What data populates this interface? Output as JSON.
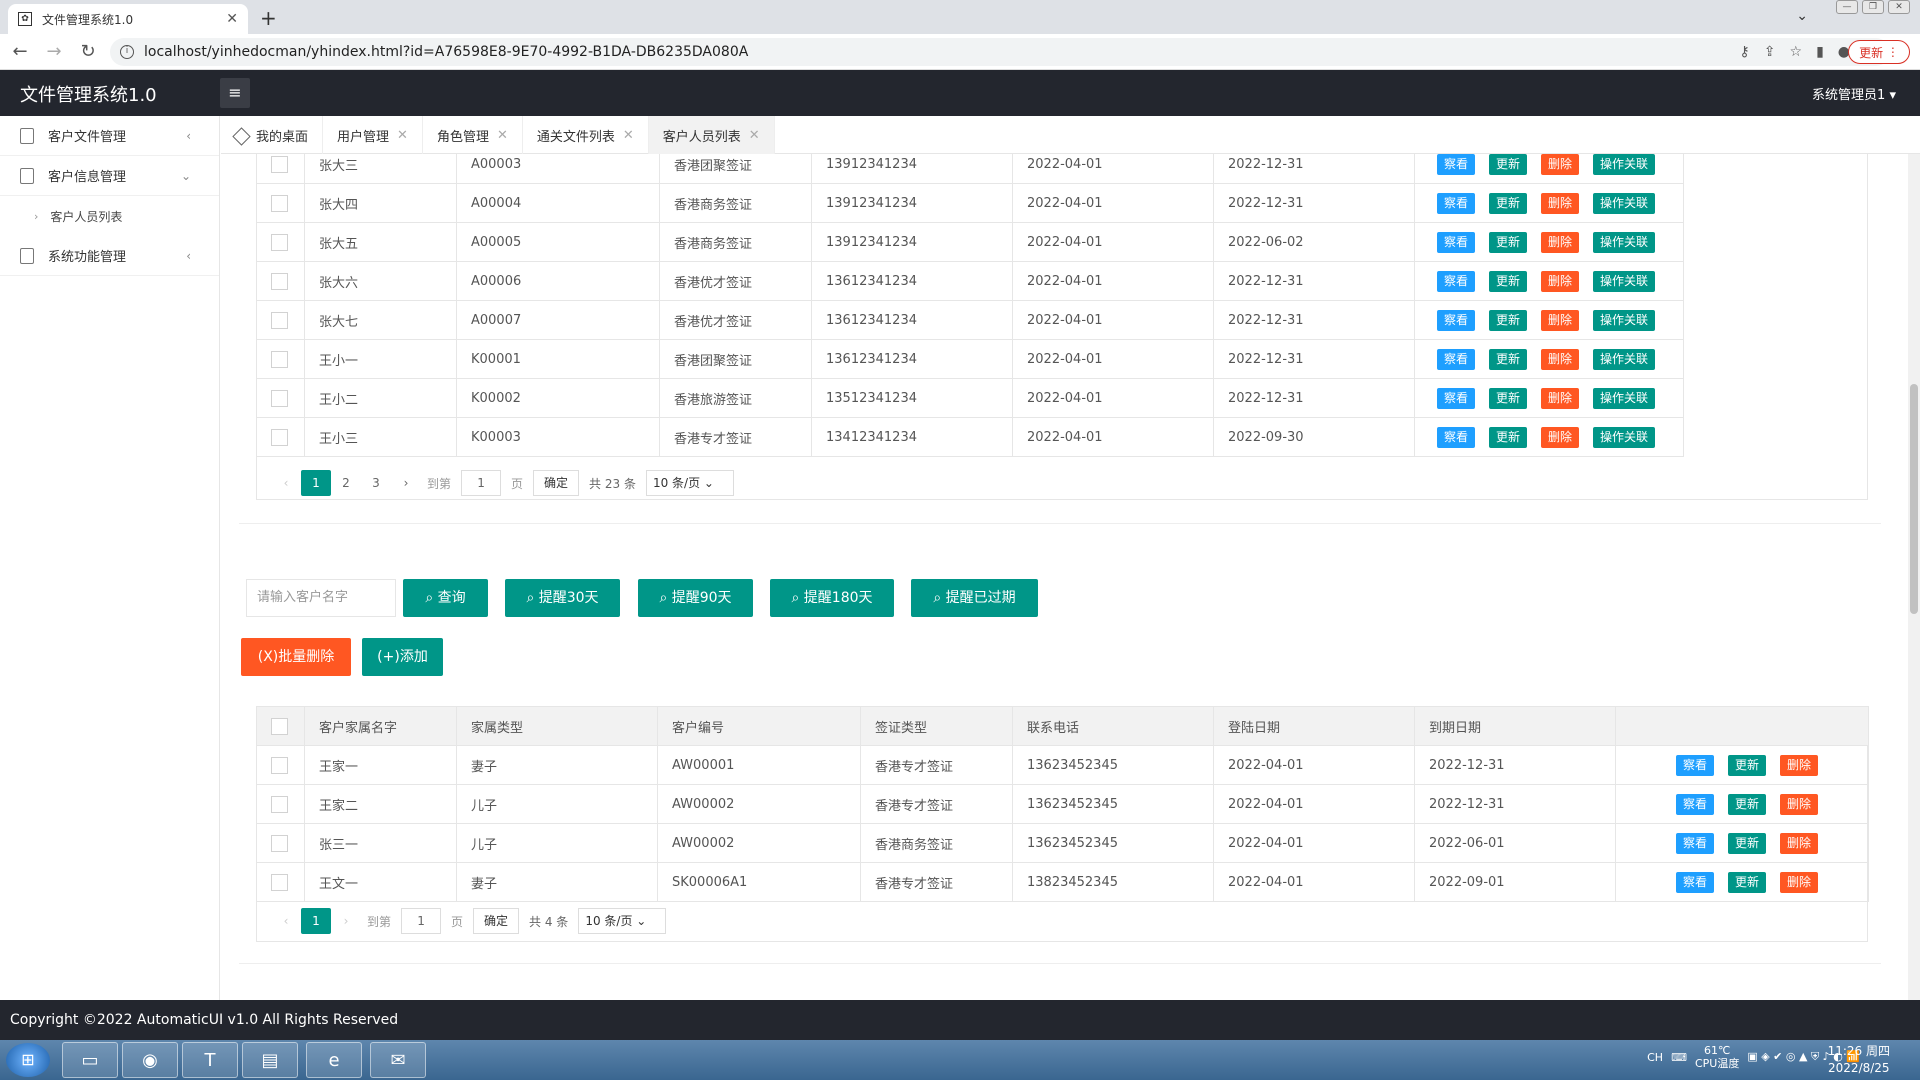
{
  "browser": {
    "tab_title": "文件管理系统1.0",
    "url": "localhost/yinhedocman/yhindex.html?id=A76598E8-9E70-4992-B1DA-DB6235DA080A",
    "update_label": "更新"
  },
  "header": {
    "logo": "文件管理系统1.0",
    "user": "系统管理员1"
  },
  "sidebar": {
    "items": [
      {
        "label": "客户文件管理"
      },
      {
        "label": "客户信息管理"
      },
      {
        "label": "客户人员列表"
      },
      {
        "label": "系统功能管理"
      }
    ]
  },
  "tabs": [
    {
      "label": "我的桌面"
    },
    {
      "label": "用户管理"
    },
    {
      "label": "角色管理"
    },
    {
      "label": "通关文件列表"
    },
    {
      "label": "客户人员列表"
    }
  ],
  "buttons": {
    "view": "察看",
    "update": "更新",
    "delete": "删除",
    "relate": "操作关联"
  },
  "table1": {
    "rows": [
      [
        "张大三",
        "A00003",
        "香港团聚签证",
        "13912341234",
        "2022-04-01",
        "2022-12-31"
      ],
      [
        "张大四",
        "A00004",
        "香港商务签证",
        "13912341234",
        "2022-04-01",
        "2022-12-31"
      ],
      [
        "张大五",
        "A00005",
        "香港商务签证",
        "13912341234",
        "2022-04-01",
        "2022-06-02"
      ],
      [
        "张大六",
        "A00006",
        "香港优才签证",
        "13612341234",
        "2022-04-01",
        "2022-12-31"
      ],
      [
        "张大七",
        "A00007",
        "香港优才签证",
        "13612341234",
        "2022-04-01",
        "2022-12-31"
      ],
      [
        "王小一",
        "K00001",
        "香港团聚签证",
        "13612341234",
        "2022-04-01",
        "2022-12-31"
      ],
      [
        "王小二",
        "K00002",
        "香港旅游签证",
        "13512341234",
        "2022-04-01",
        "2022-12-31"
      ],
      [
        "王小三",
        "K00003",
        "香港专才签证",
        "13412341234",
        "2022-04-01",
        "2022-09-30"
      ]
    ]
  },
  "pager1": {
    "pages": [
      "1",
      "2",
      "3"
    ],
    "goto": "到第",
    "page_value": "1",
    "page_unit": "页",
    "confirm": "确定",
    "total": "共 23 条",
    "per_page": "10 条/页"
  },
  "search": {
    "placeholder": "请输入客户名字",
    "query": "查询",
    "remind30": "提醒30天",
    "remind90": "提醒90天",
    "remind180": "提醒180天",
    "remind_expired": "提醒已过期",
    "batch_delete": "(X)批量删除",
    "add": "(+)添加"
  },
  "table2": {
    "headers": [
      "客户家属名字",
      "家属类型",
      "客户编号",
      "签证类型",
      "联系电话",
      "登陆日期",
      "到期日期"
    ],
    "rows": [
      [
        "王家一",
        "妻子",
        "AW00001",
        "香港专才签证",
        "13623452345",
        "2022-04-01",
        "2022-12-31"
      ],
      [
        "王家二",
        "儿子",
        "AW00002",
        "香港专才签证",
        "13623452345",
        "2022-04-01",
        "2022-12-31"
      ],
      [
        "张三一",
        "儿子",
        "AW00002",
        "香港商务签证",
        "13623452345",
        "2022-04-01",
        "2022-06-01"
      ],
      [
        "王文一",
        "妻子",
        "SK00006A1",
        "香港专才签证",
        "13823452345",
        "2022-04-01",
        "2022-09-01"
      ]
    ]
  },
  "pager2": {
    "page": "1",
    "goto": "到第",
    "page_value": "1",
    "page_unit": "页",
    "confirm": "确定",
    "total": "共 4 条",
    "per_page": "10 条/页"
  },
  "footer": {
    "text": "Copyright ©2022 AutomaticUI v1.0 All Rights Reserved"
  },
  "taskbar": {
    "lang": "CH",
    "temp": "61℃",
    "temp_label": "CPU温度",
    "time": "11:26 周四",
    "date": "2022/8/25"
  }
}
